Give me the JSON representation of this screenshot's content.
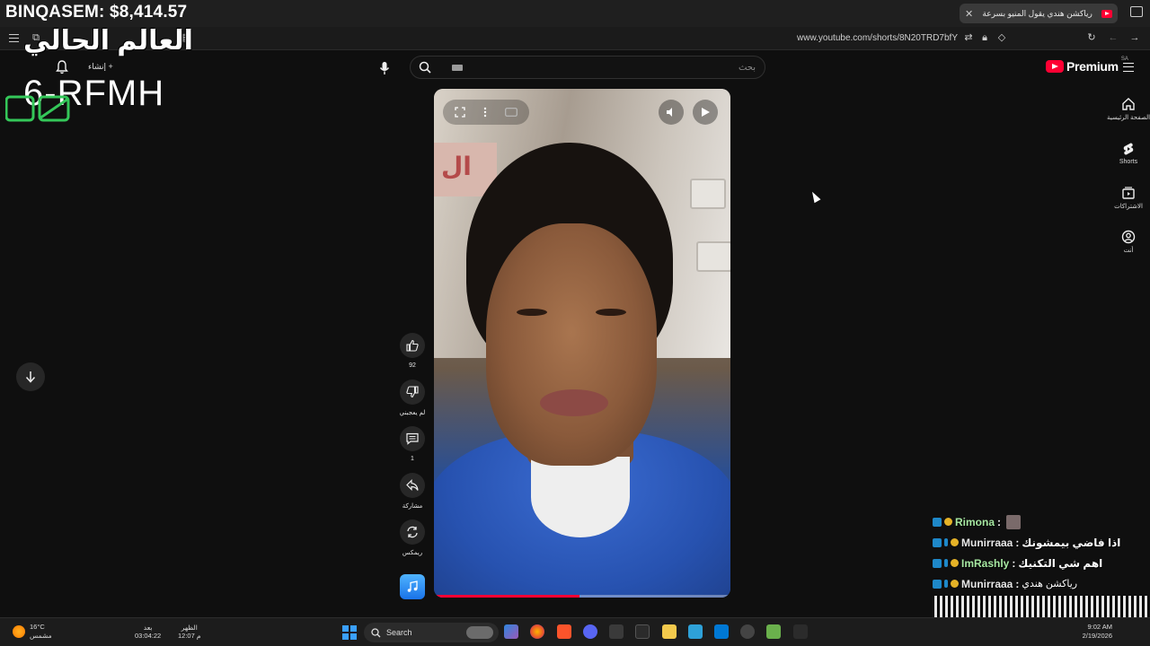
{
  "browser": {
    "tab_title": "رياكشن هندي يقول المنيو بسرعة",
    "url": "www.youtube.com/shorts/8N20TRD7bfY"
  },
  "overlay": {
    "balance": "BINQASEM: $8,414.57",
    "title_ar": "العالم الحالي",
    "code": "6-RFMH"
  },
  "youtube": {
    "create_label": "إنشاء",
    "search_placeholder": "بحث",
    "logo_word": "Premium",
    "country_code": "SA",
    "guide": [
      {
        "label": "الصفحة الرئيسية",
        "icon": "home-icon"
      },
      {
        "label": "Shorts",
        "icon": "shorts-icon"
      },
      {
        "label": "الاشتراكات",
        "icon": "subscriptions-icon"
      },
      {
        "label": "أنت",
        "icon": "you-icon"
      }
    ],
    "actions": {
      "like_count": "92",
      "dislike_label": "لم يعجبني",
      "comments_count": "1",
      "share_label": "مشاركة",
      "remix_label": "ريمكس"
    },
    "video": {
      "sign_text": "ال",
      "progress": 0.49
    }
  },
  "chat": [
    {
      "name": "Rimona",
      "message": "",
      "name_color": "#a7e8a2"
    },
    {
      "name": "Munirraaa",
      "message": "اذا فاضي بيمشونك",
      "name_color": "#e8e8e8"
    },
    {
      "name": "ImRashly",
      "message": "اهم شي التكنيك",
      "name_color": "#a7e8a2"
    },
    {
      "name": "Munirraaa",
      "message": "رياكشن هندي",
      "name_color": "#e8e8e8"
    }
  ],
  "taskbar": {
    "weather_temp": "16°C",
    "weather_desc": "مشمس",
    "clock_left_label": "بعد",
    "clock_left_value": "03:04:22",
    "clock_right_label": "الظهر",
    "clock_right_value": "12:07 م",
    "search_label": "Search",
    "time": "9:02 AM",
    "date": "2/19/2026"
  },
  "colors": {
    "yt_red": "#ff0033",
    "background": "#0f0f0f",
    "chat_green": "#a7e8a2"
  }
}
